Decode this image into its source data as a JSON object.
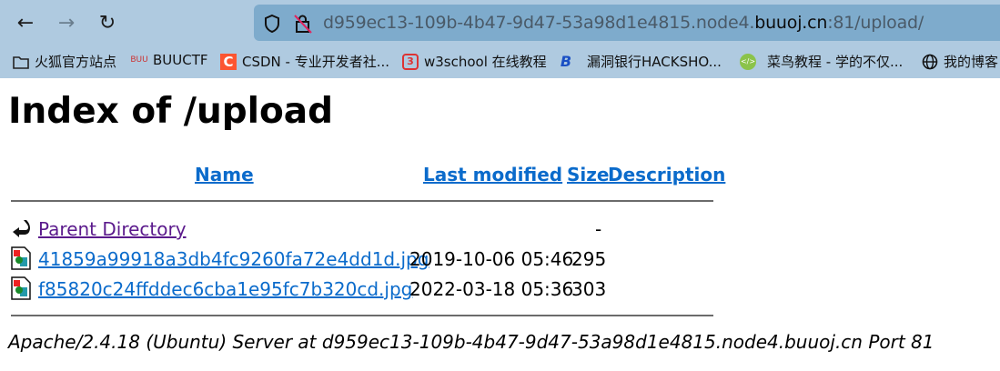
{
  "browser": {
    "url_prefix": "d959ec13-109b-4b47-9d47-53a98d1e4815.node4.",
    "url_domain": "buuoj.cn",
    "url_suffix": ":81/upload/",
    "bookmarks": [
      {
        "label": "火狐官方站点",
        "icon": "folder-icon"
      },
      {
        "label": "BUUCTF",
        "icon": "buuctf-icon"
      },
      {
        "label": "CSDN - 专业开发者社...",
        "icon": "csdn-icon"
      },
      {
        "label": "w3school 在线教程",
        "icon": "w3school-icon"
      },
      {
        "label": "漏洞银行HACKSHO...",
        "icon": "bugbank-icon"
      },
      {
        "label": "菜鸟教程 - 学的不仅...",
        "icon": "runoob-icon"
      },
      {
        "label": "我的博客",
        "icon": "globe-icon"
      }
    ]
  },
  "page": {
    "title": "Index of /upload",
    "columns": [
      "Name",
      "Last modified",
      "Size",
      "Description"
    ],
    "parent": {
      "name": "Parent Directory",
      "size": "-"
    },
    "files": [
      {
        "name": "41859a99918a3db4fc9260fa72e4dd1d.jpg",
        "modified": "2019-10-06 05:46",
        "size": "295"
      },
      {
        "name": "f85820c24ffddec6cba1e95fc7b320cd.jpg",
        "modified": "2022-03-18 05:36",
        "size": "303"
      }
    ],
    "address": "Apache/2.4.18 (Ubuntu) Server at d959ec13-109b-4b47-9d47-53a98d1e4815.node4.buuoj.cn Port 81"
  },
  "colors": {
    "link": "#0b6bcb",
    "visited": "#5b1a8c",
    "chrome": "#afcae0",
    "urlbar": "#7eabcc"
  }
}
